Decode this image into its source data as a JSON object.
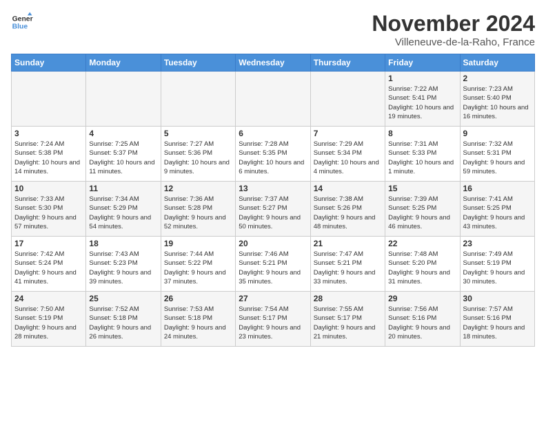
{
  "logo": {
    "line1": "General",
    "line2": "Blue"
  },
  "title": "November 2024",
  "location": "Villeneuve-de-la-Raho, France",
  "weekdays": [
    "Sunday",
    "Monday",
    "Tuesday",
    "Wednesday",
    "Thursday",
    "Friday",
    "Saturday"
  ],
  "weeks": [
    [
      {
        "day": "",
        "info": ""
      },
      {
        "day": "",
        "info": ""
      },
      {
        "day": "",
        "info": ""
      },
      {
        "day": "",
        "info": ""
      },
      {
        "day": "",
        "info": ""
      },
      {
        "day": "1",
        "info": "Sunrise: 7:22 AM\nSunset: 5:41 PM\nDaylight: 10 hours and 19 minutes."
      },
      {
        "day": "2",
        "info": "Sunrise: 7:23 AM\nSunset: 5:40 PM\nDaylight: 10 hours and 16 minutes."
      }
    ],
    [
      {
        "day": "3",
        "info": "Sunrise: 7:24 AM\nSunset: 5:38 PM\nDaylight: 10 hours and 14 minutes."
      },
      {
        "day": "4",
        "info": "Sunrise: 7:25 AM\nSunset: 5:37 PM\nDaylight: 10 hours and 11 minutes."
      },
      {
        "day": "5",
        "info": "Sunrise: 7:27 AM\nSunset: 5:36 PM\nDaylight: 10 hours and 9 minutes."
      },
      {
        "day": "6",
        "info": "Sunrise: 7:28 AM\nSunset: 5:35 PM\nDaylight: 10 hours and 6 minutes."
      },
      {
        "day": "7",
        "info": "Sunrise: 7:29 AM\nSunset: 5:34 PM\nDaylight: 10 hours and 4 minutes."
      },
      {
        "day": "8",
        "info": "Sunrise: 7:31 AM\nSunset: 5:33 PM\nDaylight: 10 hours and 1 minute."
      },
      {
        "day": "9",
        "info": "Sunrise: 7:32 AM\nSunset: 5:31 PM\nDaylight: 9 hours and 59 minutes."
      }
    ],
    [
      {
        "day": "10",
        "info": "Sunrise: 7:33 AM\nSunset: 5:30 PM\nDaylight: 9 hours and 57 minutes."
      },
      {
        "day": "11",
        "info": "Sunrise: 7:34 AM\nSunset: 5:29 PM\nDaylight: 9 hours and 54 minutes."
      },
      {
        "day": "12",
        "info": "Sunrise: 7:36 AM\nSunset: 5:28 PM\nDaylight: 9 hours and 52 minutes."
      },
      {
        "day": "13",
        "info": "Sunrise: 7:37 AM\nSunset: 5:27 PM\nDaylight: 9 hours and 50 minutes."
      },
      {
        "day": "14",
        "info": "Sunrise: 7:38 AM\nSunset: 5:26 PM\nDaylight: 9 hours and 48 minutes."
      },
      {
        "day": "15",
        "info": "Sunrise: 7:39 AM\nSunset: 5:25 PM\nDaylight: 9 hours and 46 minutes."
      },
      {
        "day": "16",
        "info": "Sunrise: 7:41 AM\nSunset: 5:25 PM\nDaylight: 9 hours and 43 minutes."
      }
    ],
    [
      {
        "day": "17",
        "info": "Sunrise: 7:42 AM\nSunset: 5:24 PM\nDaylight: 9 hours and 41 minutes."
      },
      {
        "day": "18",
        "info": "Sunrise: 7:43 AM\nSunset: 5:23 PM\nDaylight: 9 hours and 39 minutes."
      },
      {
        "day": "19",
        "info": "Sunrise: 7:44 AM\nSunset: 5:22 PM\nDaylight: 9 hours and 37 minutes."
      },
      {
        "day": "20",
        "info": "Sunrise: 7:46 AM\nSunset: 5:21 PM\nDaylight: 9 hours and 35 minutes."
      },
      {
        "day": "21",
        "info": "Sunrise: 7:47 AM\nSunset: 5:21 PM\nDaylight: 9 hours and 33 minutes."
      },
      {
        "day": "22",
        "info": "Sunrise: 7:48 AM\nSunset: 5:20 PM\nDaylight: 9 hours and 31 minutes."
      },
      {
        "day": "23",
        "info": "Sunrise: 7:49 AM\nSunset: 5:19 PM\nDaylight: 9 hours and 30 minutes."
      }
    ],
    [
      {
        "day": "24",
        "info": "Sunrise: 7:50 AM\nSunset: 5:19 PM\nDaylight: 9 hours and 28 minutes."
      },
      {
        "day": "25",
        "info": "Sunrise: 7:52 AM\nSunset: 5:18 PM\nDaylight: 9 hours and 26 minutes."
      },
      {
        "day": "26",
        "info": "Sunrise: 7:53 AM\nSunset: 5:18 PM\nDaylight: 9 hours and 24 minutes."
      },
      {
        "day": "27",
        "info": "Sunrise: 7:54 AM\nSunset: 5:17 PM\nDaylight: 9 hours and 23 minutes."
      },
      {
        "day": "28",
        "info": "Sunrise: 7:55 AM\nSunset: 5:17 PM\nDaylight: 9 hours and 21 minutes."
      },
      {
        "day": "29",
        "info": "Sunrise: 7:56 AM\nSunset: 5:16 PM\nDaylight: 9 hours and 20 minutes."
      },
      {
        "day": "30",
        "info": "Sunrise: 7:57 AM\nSunset: 5:16 PM\nDaylight: 9 hours and 18 minutes."
      }
    ]
  ]
}
